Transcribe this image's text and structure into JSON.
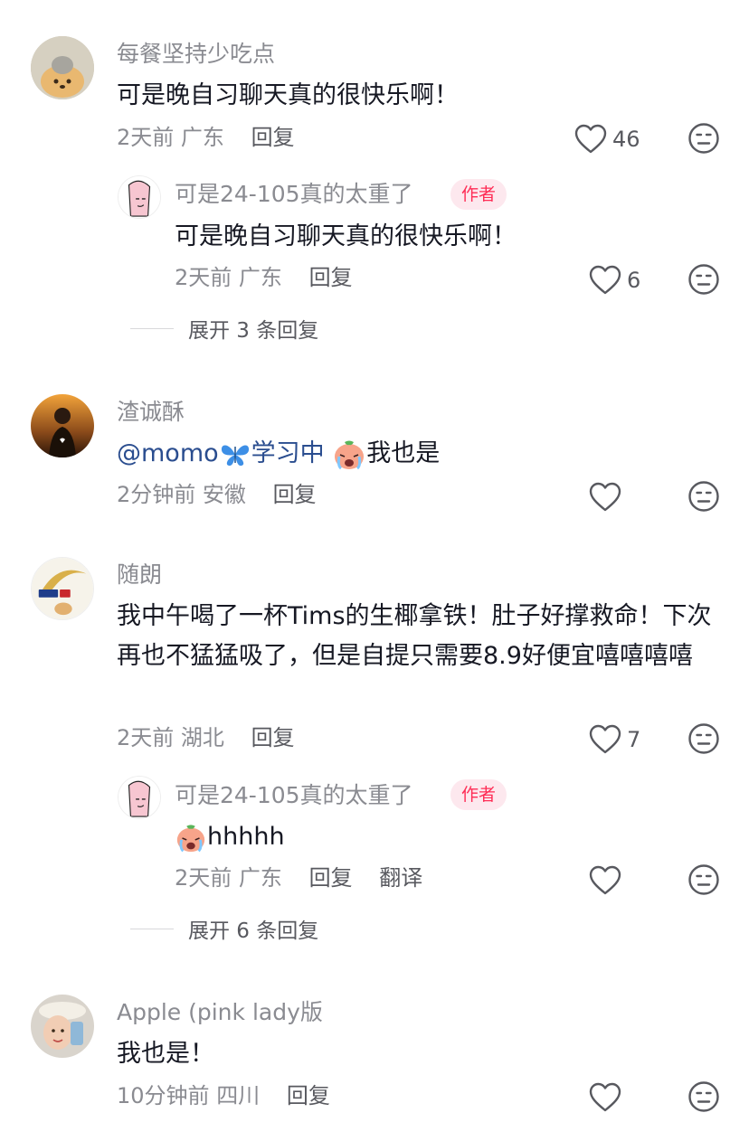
{
  "comments": [
    {
      "username": "每餐坚持少吃点",
      "content": "可是晚自习聊天真的很快乐啊！",
      "time": "2天前",
      "location": "广东",
      "reply_label": "回复",
      "likes": "46",
      "replies": [
        {
          "username": "可是24-105真的太重了",
          "author_badge": "作者",
          "content": "可是晚自习聊天真的很快乐啊！",
          "time": "2天前",
          "location": "广东",
          "reply_label": "回复",
          "likes": "6"
        }
      ],
      "expand_label": "展开 3 条回复"
    },
    {
      "username": "渣诚酥",
      "content_mention": "@momo",
      "content_mid": "学习中",
      "content_end": "我也是",
      "time": "2分钟前",
      "location": "安徽",
      "reply_label": "回复"
    },
    {
      "username": "随朗",
      "content": "我中午喝了一杯Tims的生椰拿铁！肚子好撑救命！下次再也不猛猛吸了，但是自提只需要8.9好便宜嘻嘻嘻嘻",
      "time": "2天前",
      "location": "湖北",
      "reply_label": "回复",
      "likes": "7",
      "replies": [
        {
          "username": "可是24-105真的太重了",
          "author_badge": "作者",
          "content": "hhhhh",
          "time": "2天前",
          "location": "广东",
          "reply_label": "回复",
          "translate_label": "翻译"
        }
      ],
      "expand_label": "展开 6 条回复"
    },
    {
      "username": "Apple (pink lady版",
      "content": "我也是！",
      "time": "10分钟前",
      "location": "四川",
      "reply_label": "回复"
    }
  ],
  "avatar_images": {
    "c0": "bear-avatar",
    "c1": "sunset-portrait-avatar",
    "c2": "cctv-logo-avatar",
    "c3": "selfie-avatar",
    "author": "pink-cartoon-avatar"
  },
  "colors": {
    "text_primary": "#161823",
    "text_secondary": "#8a8b91",
    "author_badge_bg": "#fde8ee",
    "author_badge_text": "#fe2c55",
    "mention": "#2a4d8f"
  }
}
